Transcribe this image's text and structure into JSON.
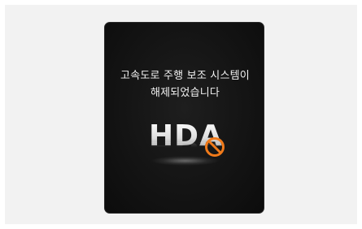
{
  "screen": {
    "message_line_1": "고속도로 주행 보조 시스템이",
    "message_line_2": "해제되었습니다",
    "logo_text": "HDA",
    "icon": "no-entry-icon",
    "colors": {
      "background": "#141414",
      "text": "#f2f2f2",
      "icon_accent": "#f07a1a"
    }
  }
}
